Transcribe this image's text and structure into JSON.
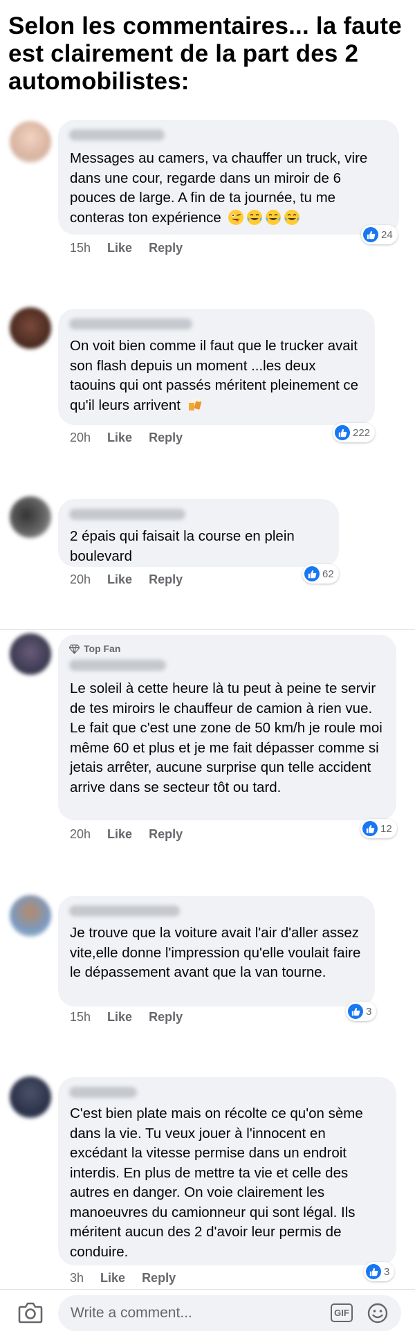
{
  "headline": "Selon les commentaires... la faute est clairement de la part des 2 automobilistes:",
  "comments": [
    {
      "text": "Messages au camers, va chauffer un truck, vire dans une cour, regarde dans un miroir de 6 pouces de large. A fin de ta journée, tu me conteras ton expérience",
      "emoji": [
        "winking-face-tongue",
        "tears-of-joy",
        "tears-of-joy",
        "tears-of-joy"
      ],
      "time": "15h",
      "like": "Like",
      "reply": "Reply",
      "reactions": "24"
    },
    {
      "text": "On voit bien comme il faut que le trucker avait son flash depuis un moment ...les deux taouins qui ont passés méritent pleinement ce qu'il leurs arrivent",
      "emoji": [
        "beer-mugs"
      ],
      "time": "20h",
      "like": "Like",
      "reply": "Reply",
      "reactions": "222"
    },
    {
      "text": "2 épais qui faisait la course en plein boulevard",
      "time": "20h",
      "like": "Like",
      "reply": "Reply",
      "reactions": "62"
    },
    {
      "badge": "Top Fan",
      "text": "Le soleil à cette heure là tu peut à peine te servir de tes miroirs le chauffeur de camion à rien vue. Le fait que c'est une zone de 50 km/h je roule moi même 60 et plus et je me fait dépasser comme si jetais arrêter, aucune surprise qun telle accident arrive dans se secteur tôt ou tard.",
      "time": "20h",
      "like": "Like",
      "reply": "Reply",
      "reactions": "12"
    },
    {
      "text": "Je trouve que la voiture avait l'air d'aller assez vite,elle donne l'impression qu'elle voulait faire le dépassement avant que la van tourne.",
      "time": "15h",
      "like": "Like",
      "reply": "Reply",
      "reactions": "3"
    },
    {
      "text": "C'est bien plate mais on récolte ce qu'on sème dans la vie. Tu veux jouer à l'innocent en excédant la vitesse permise dans un endroit interdis. En plus de mettre ta vie et celle des autres en danger. On voie clairement les manoeuvres du camionneur qui sont légal. Ils méritent aucun des 2 d'avoir leur permis de conduire.",
      "time": "3h",
      "like": "Like",
      "reply": "Reply",
      "reactions": "3"
    }
  ],
  "composer": {
    "placeholder": "Write a comment...",
    "gif_label": "GIF"
  },
  "colors": {
    "bubble": "#f0f2f5",
    "meta_text": "#65676b",
    "like_blue": "#1877f2"
  }
}
